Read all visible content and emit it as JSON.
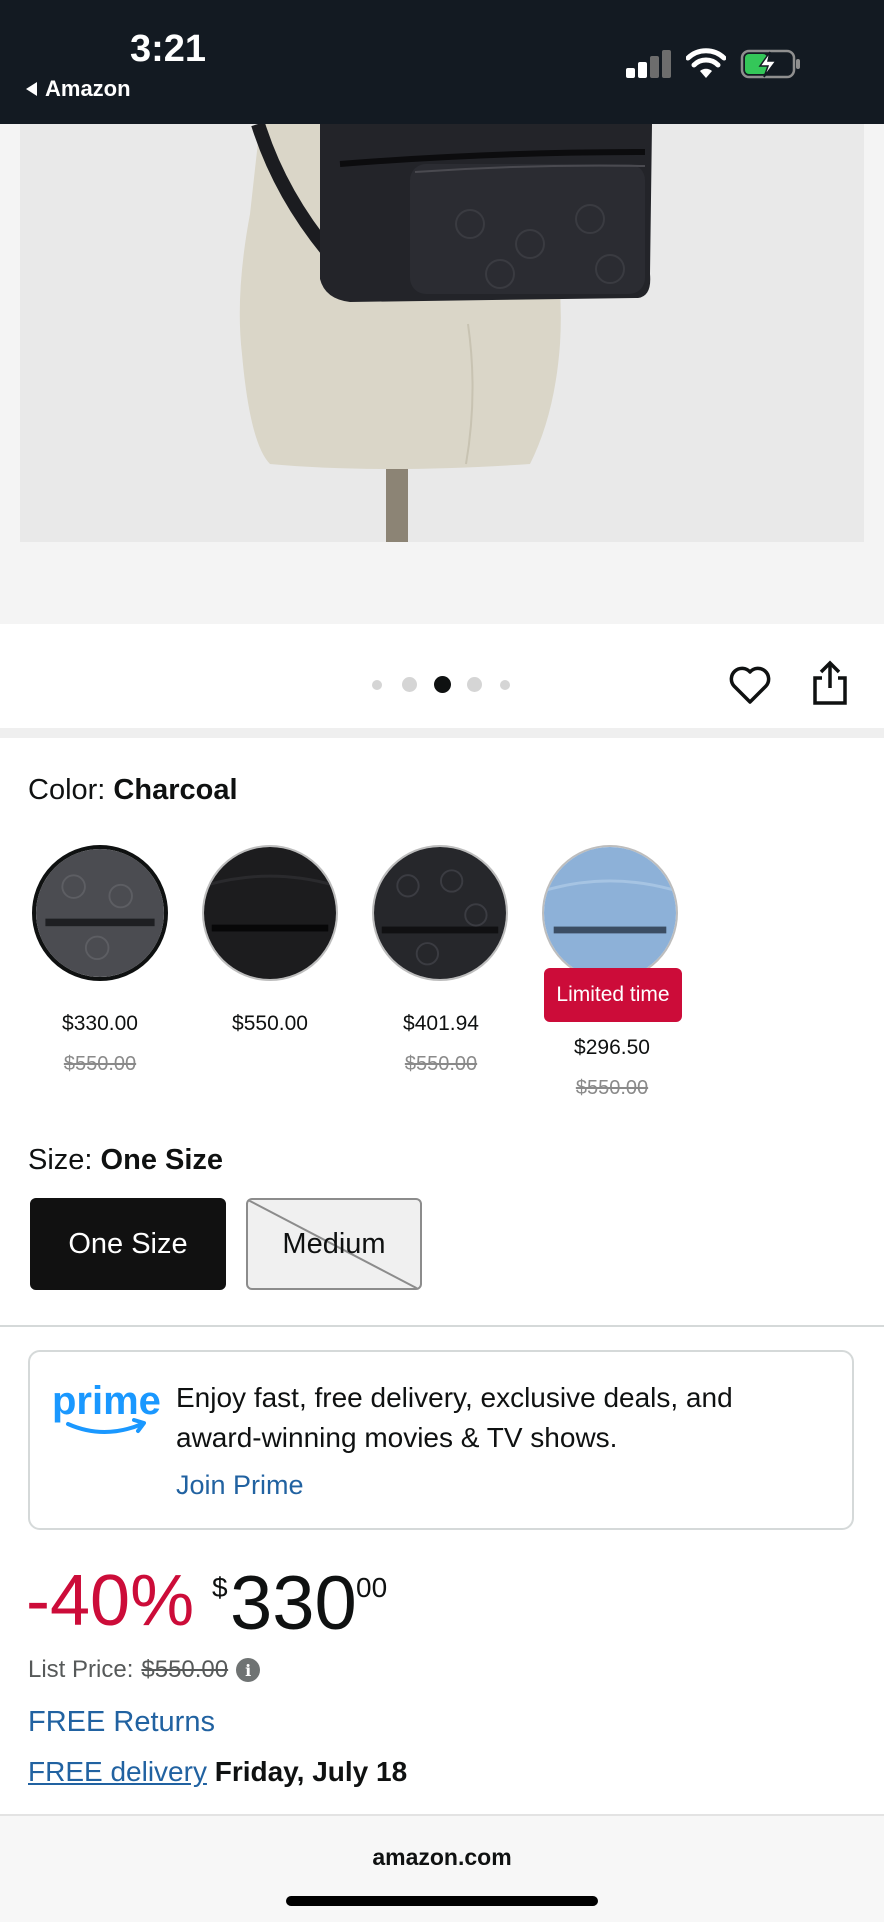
{
  "status_bar": {
    "time": "3:21",
    "back_app": "Amazon",
    "icons": [
      "signal-icon",
      "wifi-icon",
      "battery-charging-icon"
    ]
  },
  "gallery": {
    "image_alt": "charcoal backpack on mannequin",
    "page_count": 5,
    "active_index": 2,
    "actions": [
      "heart-icon",
      "share-icon"
    ]
  },
  "color_section": {
    "label": "Color:",
    "selected": "Charcoal",
    "options": [
      {
        "name": "charcoal",
        "price": "$330.00",
        "list_price": "$550.00",
        "badge": ""
      },
      {
        "name": "black",
        "price": "$550.00",
        "list_price": "",
        "badge": ""
      },
      {
        "name": "black-signature",
        "price": "$401.94",
        "list_price": "$550.00",
        "badge": ""
      },
      {
        "name": "denim",
        "price": "$296.50",
        "list_price": "$550.00",
        "badge": "Limited time"
      }
    ]
  },
  "size_section": {
    "label": "Size:",
    "selected": "One Size",
    "options": [
      {
        "label": "One Size",
        "state": "selected"
      },
      {
        "label": "Medium",
        "state": "unavailable"
      }
    ]
  },
  "prime": {
    "logo": "prime",
    "text": "Enjoy fast, free delivery, exclusive deals, and award-winning movies & TV shows.",
    "link": "Join Prime"
  },
  "pricing": {
    "discount": "-40%",
    "currency": "$",
    "whole": "330",
    "fraction": "00",
    "list_label": "List Price:",
    "list_price": "$550.00"
  },
  "delivery": {
    "returns": "FREE Returns",
    "delivery_link": "FREE delivery",
    "delivery_date": "Friday, July 18"
  },
  "footer": {
    "domain": "amazon.com"
  },
  "colors": {
    "accent_red": "#cc0c39",
    "link_blue": "#2162a1",
    "status_bar_bg": "#131a22"
  }
}
